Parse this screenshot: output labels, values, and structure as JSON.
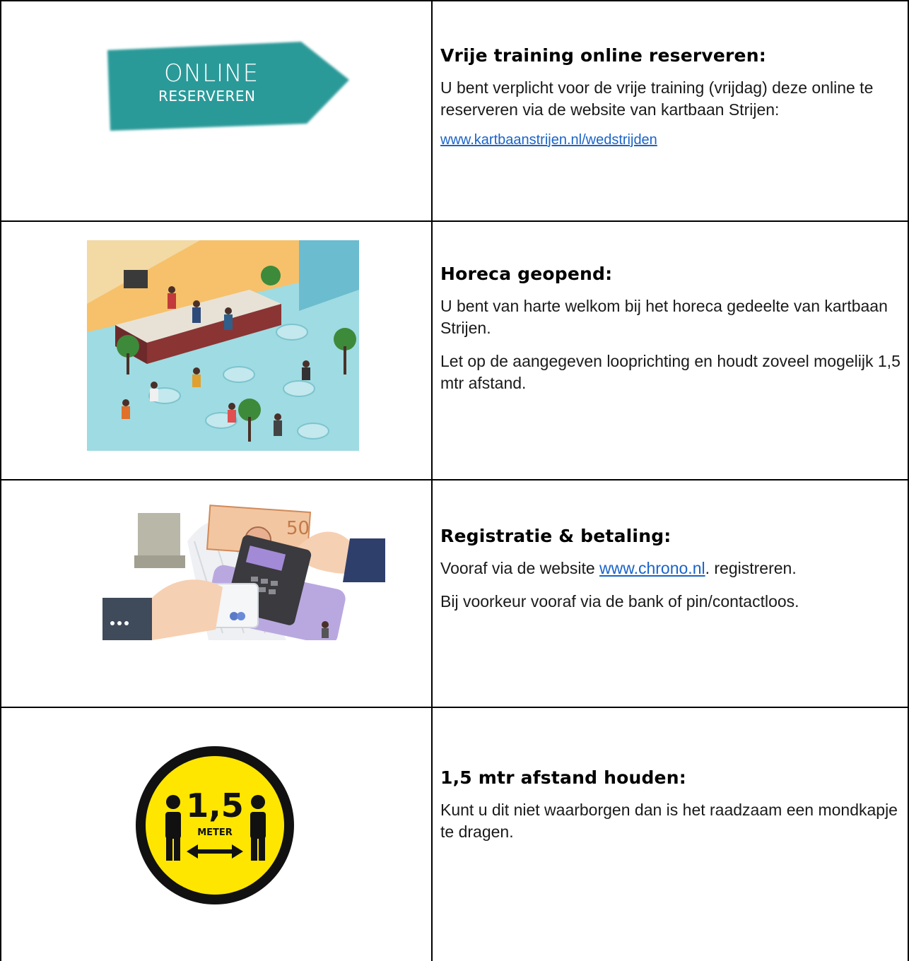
{
  "sections": [
    {
      "title": "Vrije training online reserveren:",
      "paragraphs": [
        "U bent verplicht voor de vrije training (vrijdag) deze online te reserveren via de website van kartbaan Strijen:"
      ],
      "link": "www.kartbaanstrijen.nl/wedstrijden",
      "image": {
        "line1": "ONLINE",
        "line2": "RESERVEREN",
        "color": "#2a9a99"
      }
    },
    {
      "title": "Horeca geopend:",
      "paragraphs": [
        "U bent van harte welkom bij het horeca gedeelte van kartbaan Strijen.",
        "Let op de aangegeven looprichting en houdt zoveel mogelijk 1,5 mtr afstand."
      ]
    },
    {
      "title": "Registratie & betaling:",
      "line1": {
        "before": "Vooraf via de website ",
        "link": "www.chrono.nl",
        "after": ". registreren."
      },
      "paragraphs": [
        "Bij voorkeur vooraf via de bank of pin/contactloos."
      ],
      "image": {
        "banknote": "50"
      }
    },
    {
      "title": "1,5 mtr afstand houden:",
      "paragraphs": [
        "Kunt u dit niet waarborgen dan is het raadzaam een mondkapje te dragen."
      ],
      "image": {
        "number": "1,5",
        "unit": "METER",
        "circle_color": "#ffe600"
      }
    }
  ]
}
